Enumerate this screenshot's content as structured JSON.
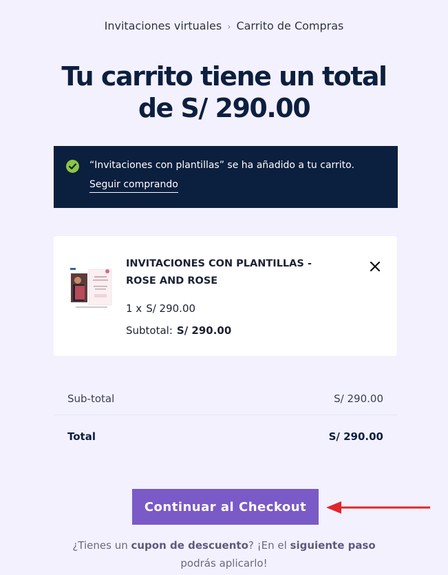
{
  "breadcrumb": {
    "items": [
      "Invitaciones virtuales",
      "Carrito de Compras"
    ],
    "separator": "›"
  },
  "page_title": "Tu carrito tiene un total de S/ 290.00",
  "notice": {
    "message": "“Invitaciones con plantillas” se ha añadido a tu carrito.",
    "continue_label": "Seguir comprando"
  },
  "cart_item": {
    "name": "INVITACIONES CON PLANTILLAS - ROSE AND ROSE",
    "quantity": "1 x",
    "unit_price": "S/ 290.00",
    "subtotal_label": "Subtotal:",
    "subtotal_value": "S/ 290.00",
    "remove_icon": "close-icon"
  },
  "totals": {
    "subtotal_label": "Sub-total",
    "subtotal_value": "S/ 290.00",
    "total_label": "Total",
    "total_value": "S/ 290.00"
  },
  "checkout_label": "Continuar al Checkout",
  "coupon": {
    "p1": "¿Tienes un ",
    "b1": "cupon de descuento",
    "p2": "? ¡En el ",
    "b2": "siguiente paso",
    "p3": " podrás aplicarlo!"
  },
  "colors": {
    "accent": "#7a5ac6",
    "notice_bg": "#0b1f3e",
    "check": "#8cc63f",
    "arrow": "#e0262b"
  }
}
